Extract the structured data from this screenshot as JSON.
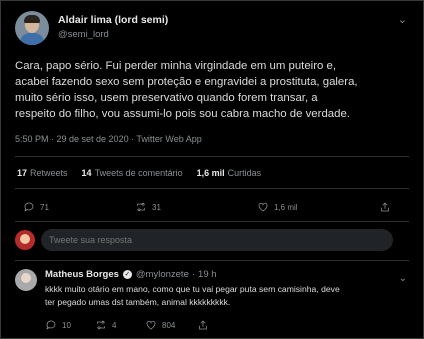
{
  "tweet": {
    "author_name": "Aldair lima (lord semi)",
    "author_handle": "@semi_lord",
    "text_lines": [
      "Cara, papo sério. Fui perder minha virgindade em um puteiro e,",
      "acabei fazendo sexo sem proteção e engravidei a prostituta, galera,",
      "muito sério isso, usem preservativo quando forem transar, a",
      "respeito do filho, vou assumi-lo pois sou cabra macho de verdade."
    ],
    "meta": "5:50 PM · 29 de set de 2020 · Twitter Web App"
  },
  "stats": {
    "retweets_count": "17",
    "retweets_label": "Retweets",
    "quote_count": "14",
    "quote_label": "Tweets de comentário",
    "likes_count": "1,6 mil",
    "likes_label": "Curtidas"
  },
  "actions": {
    "reply_count": "71",
    "retweet_count": "31",
    "like_count": "1,6 mil"
  },
  "reply_box": {
    "placeholder": "Tweete sua resposta"
  },
  "reply": {
    "name": "Matheus Borges",
    "handle": "@mylonzete",
    "time": "19 h",
    "text_lines": [
      "kkkk muito otário em mano, como que tu vai pegar puta sem camisinha, deve",
      "ter pegado umas dst também, animal kkkkkkkkk."
    ],
    "reply_count": "10",
    "retweet_count": "4",
    "like_count": "804"
  },
  "icons": {
    "more": "more-icon",
    "reply": "reply-icon",
    "retweet": "retweet-icon",
    "like": "heart-icon",
    "share": "share-icon",
    "verified": "verified-icon"
  }
}
